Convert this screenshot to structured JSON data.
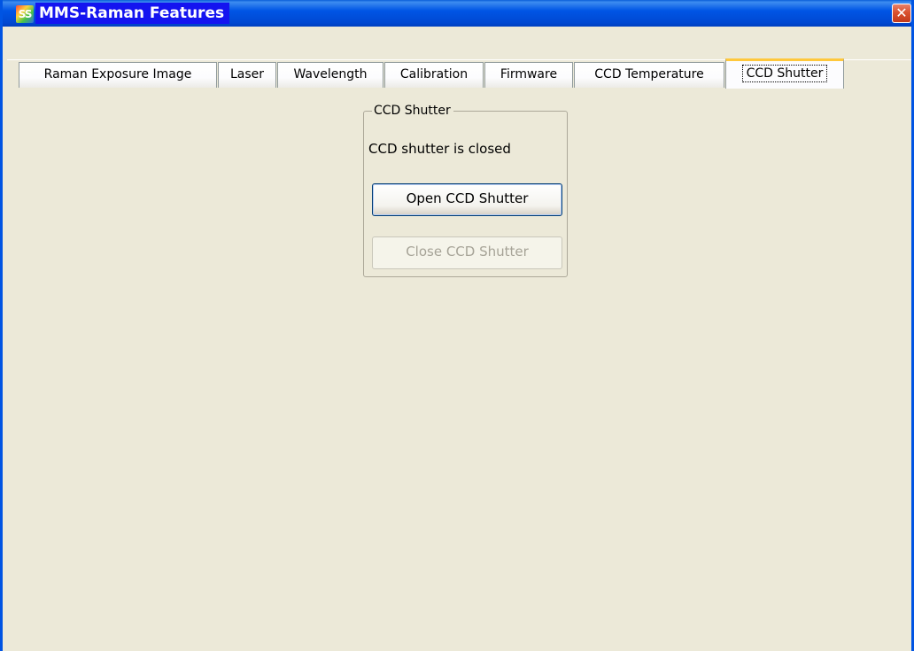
{
  "window": {
    "title": "MMS-Raman Features",
    "app_icon": "SS-logo-icon",
    "close_icon": "close-icon",
    "close_glyph": "✕"
  },
  "tabs": [
    {
      "label": "Raman Exposure Image",
      "active": false
    },
    {
      "label": "Laser",
      "active": false
    },
    {
      "label": "Wavelength",
      "active": false
    },
    {
      "label": "Calibration",
      "active": false
    },
    {
      "label": "Firmware",
      "active": false
    },
    {
      "label": "CCD Temperature",
      "active": false
    },
    {
      "label": "CCD Shutter",
      "active": true
    }
  ],
  "shutter_panel": {
    "group_title": "CCD Shutter",
    "status": "CCD shutter is closed",
    "open_button": {
      "label": "Open CCD Shutter",
      "enabled": true
    },
    "close_button": {
      "label": "Close CCD Shutter",
      "enabled": false
    }
  },
  "colors": {
    "titlebar": "#0055e5",
    "title_highlight": "#1414f0",
    "active_tab_accent": "#ffc83c",
    "panel_background": "#ece9d8",
    "disabled_text": "#a6a397"
  }
}
